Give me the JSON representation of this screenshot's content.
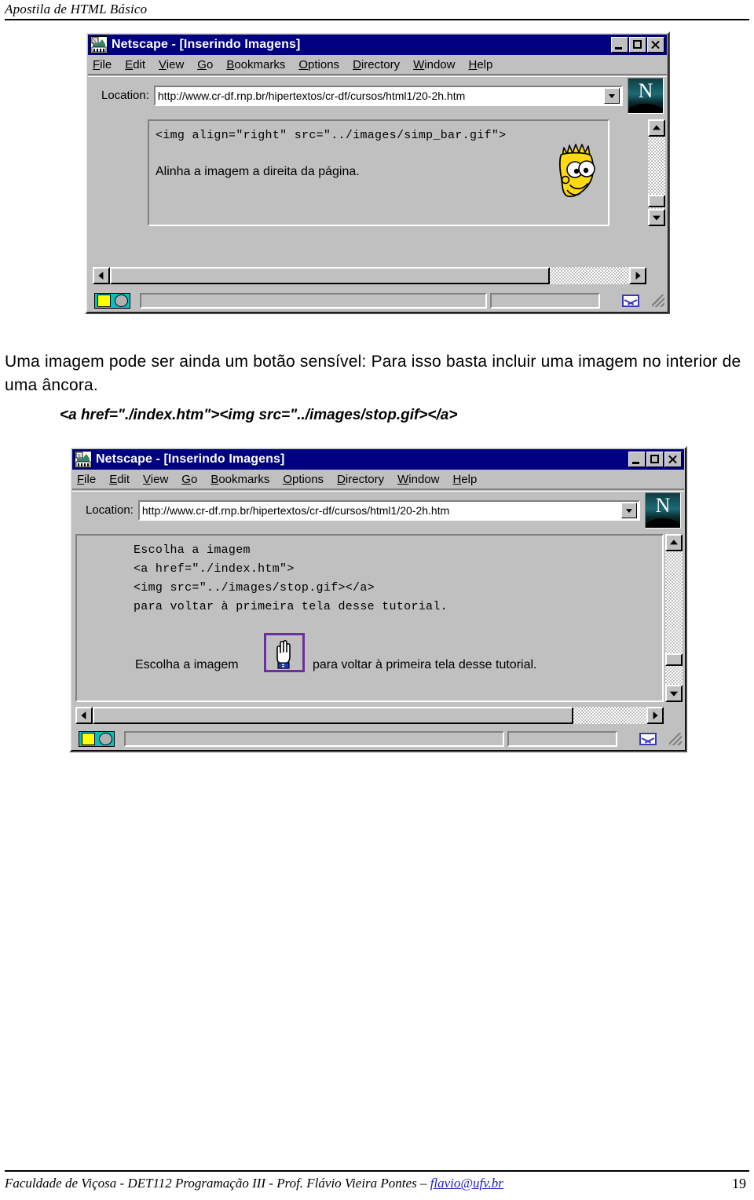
{
  "page": {
    "header_title": "Apostila de HTML Básico",
    "footer_text_before": "Faculdade de Viçosa - DET112  Programação III -  Prof. Flávio Vieira Pontes – ",
    "footer_email": "flavio@ufv.br",
    "page_number": "19"
  },
  "paragraph": {
    "line1": "Uma imagem pode ser ainda um botão sensível: Para isso basta incluir uma imagem no interior de",
    "line2": "uma âncora.",
    "code_snippet": "<a href=\"./index.htm\"><img src=\"../images/stop.gif></a>"
  },
  "browser": {
    "title": "Netscape - [Inserindo Imagens]",
    "menu": [
      {
        "pre": "",
        "key": "F",
        "post": "ile"
      },
      {
        "pre": "",
        "key": "E",
        "post": "dit"
      },
      {
        "pre": "",
        "key": "V",
        "post": "iew"
      },
      {
        "pre": "",
        "key": "G",
        "post": "o"
      },
      {
        "pre": "",
        "key": "B",
        "post": "ookmarks"
      },
      {
        "pre": "",
        "key": "O",
        "post": "ptions"
      },
      {
        "pre": "",
        "key": "D",
        "post": "irectory"
      },
      {
        "pre": "",
        "key": "W",
        "post": "indow"
      },
      {
        "pre": "",
        "key": "H",
        "post": "elp"
      }
    ],
    "location_label": "Location:",
    "location_url": "http://www.cr-df.rnp.br/hipertextos/cr-df/cursos/html1/20-2h.htm",
    "logo_letter": "N",
    "window_buttons": {
      "minimize": "minimize",
      "maximize": "maximize",
      "close": "close"
    }
  },
  "window1": {
    "code_line": "<img align=\"right\" src=\"../images/simp_bar.gif\">",
    "body_line": "Alinha a imagem a direita da página.",
    "image_alt": "bart-simpson"
  },
  "window2": {
    "code_lines": [
      "Escolha a imagem",
      "<a href=\"./index.htm\">",
      "<img src=\"../images/stop.gif></a>",
      "para voltar à primeira tela desse tutorial."
    ],
    "rendered_before": "Escolha a imagem",
    "rendered_after": "para voltar à primeira tela desse tutorial.",
    "image_alt": "hand-cursor"
  },
  "colors": {
    "titlebar": "#000080",
    "face": "#c0c0c0",
    "link_border": "#6b2fa0",
    "email_link": "#2020c0"
  }
}
